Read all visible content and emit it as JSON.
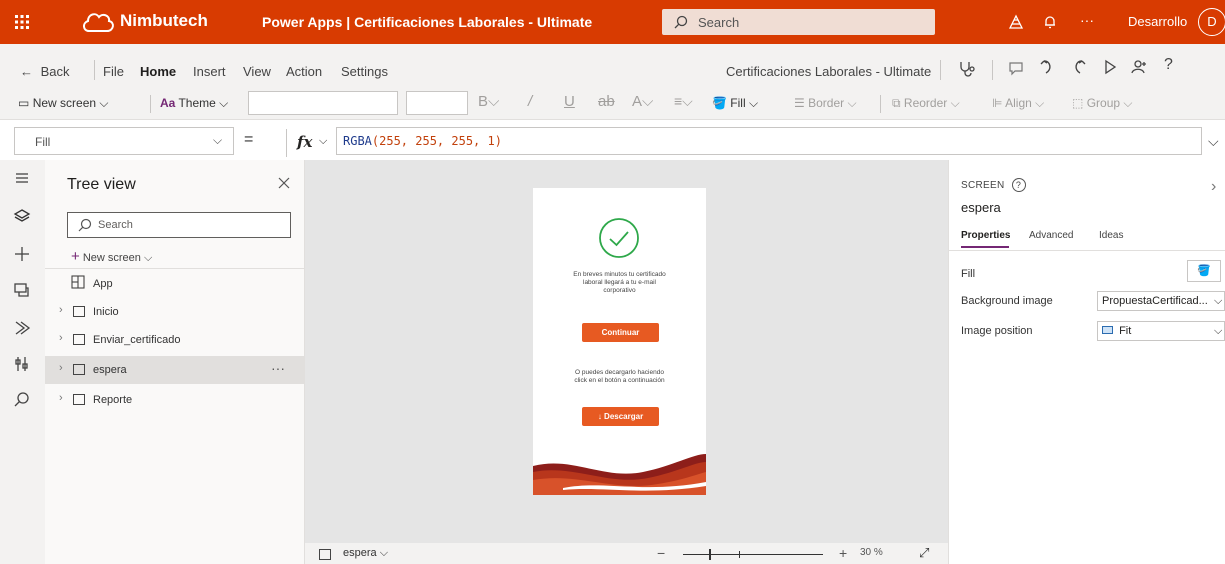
{
  "topbar": {
    "brand": "Nimbutech",
    "app_title": "Power Apps | Certificaciones Laborales - Ultimate",
    "search_placeholder": "Search",
    "more": "···",
    "environment": "Desarrollo",
    "avatar_initial": "D"
  },
  "menu": {
    "back": "Back",
    "items": [
      "File",
      "Home",
      "Insert",
      "View",
      "Action",
      "Settings"
    ],
    "active": "Home",
    "app_name": "Certificaciones Laborales - Ultimate"
  },
  "ribbon": {
    "new_screen": "New screen",
    "theme": "Theme",
    "fill": "Fill",
    "border": "Border",
    "reorder": "Reorder",
    "align": "Align",
    "group": "Group"
  },
  "formula": {
    "property": "Fill",
    "equals": "=",
    "fx": "fx",
    "fn": "RGBA",
    "args": "(255, 255, 255, 1)"
  },
  "tree": {
    "title": "Tree view",
    "search_placeholder": "Search",
    "new_screen": "New screen",
    "app": "App",
    "screens": [
      "Inicio",
      "Enviar_certificado",
      "espera",
      "Reporte"
    ],
    "selected": "espera",
    "more": "···"
  },
  "phone": {
    "message1": [
      "En breves minutos tu certificado",
      "laboral llegará a tu e-mail",
      "corporativo"
    ],
    "continue_button": "Continuar",
    "message2": [
      "O puedes decargarlo haciendo",
      "click en el botón a continuación"
    ],
    "download_button": "Descargar"
  },
  "canvas_bottom": {
    "screen_name": "espera",
    "zoom": "30 %",
    "zoom_level": 0.3
  },
  "properties": {
    "kind": "SCREEN",
    "name": "espera",
    "tabs": [
      "Properties",
      "Advanced",
      "Ideas"
    ],
    "active_tab": "Properties",
    "fill_label": "Fill",
    "background_image_label": "Background image",
    "background_image_value": "PropuestaCertificad...",
    "image_position_label": "Image position",
    "image_position_value": "Fit"
  },
  "colors": {
    "brand": "#d83b01",
    "accent": "#742774",
    "button": "#e75a22",
    "check": "#2ea84a"
  }
}
